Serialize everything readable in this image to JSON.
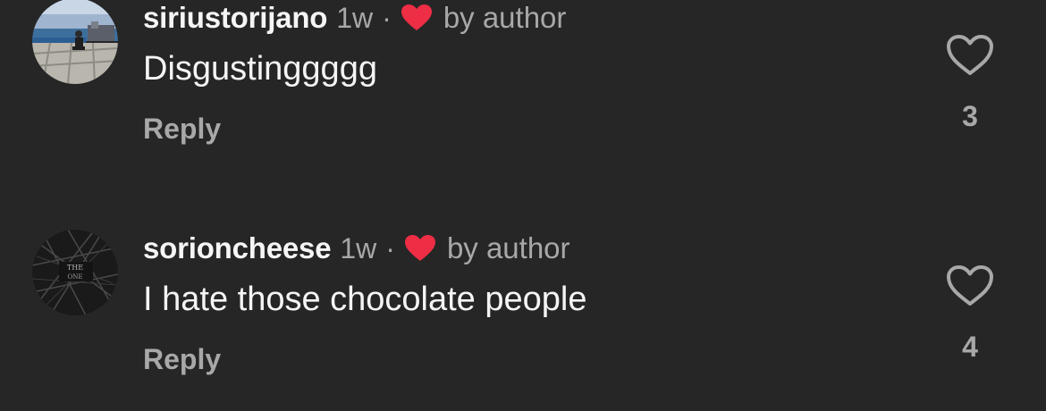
{
  "comments": [
    {
      "username": "siriustorijano",
      "time": "1w",
      "separator": "·",
      "by_author": "by author",
      "text": "Disgustinggggg",
      "reply_label": "Reply",
      "like_count": "3",
      "avatar_icon": "photo-avatar-icon"
    },
    {
      "username": "sorioncheese",
      "time": "1w",
      "separator": "·",
      "by_author": "by author",
      "text": "I hate those chocolate people",
      "reply_label": "Reply",
      "like_count": "4",
      "avatar_icon": "photo-avatar-icon",
      "avatar_text": "THE ONE"
    }
  ],
  "colors": {
    "background": "#262626",
    "primary_text": "#f5f5f5",
    "secondary_text": "#a8a8a8",
    "author_heart": "#ed2e45"
  }
}
